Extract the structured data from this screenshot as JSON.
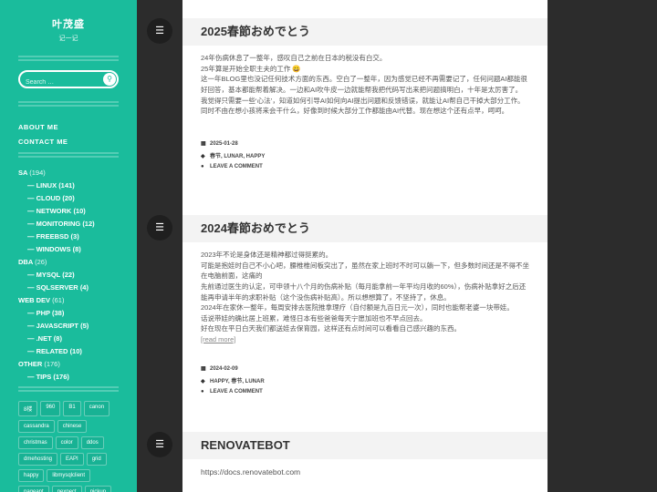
{
  "sidebar": {
    "title": "叶茂盛",
    "description": "记一记",
    "search_placeholder": "Search …",
    "search_icon": "search-icon",
    "nav": [
      "ABOUT ME",
      "CONTACT ME"
    ],
    "categories": [
      {
        "name": "SA",
        "count": "(194)",
        "children": [
          {
            "name": "LINUX",
            "count": "(141)"
          },
          {
            "name": "CLOUD",
            "count": "(20)"
          },
          {
            "name": "NETWORK",
            "count": "(10)"
          },
          {
            "name": "MONITORING",
            "count": "(12)"
          },
          {
            "name": "FREEBSD",
            "count": "(3)"
          },
          {
            "name": "WINDOWS",
            "count": "(8)"
          }
        ]
      },
      {
        "name": "DBA",
        "count": "(26)",
        "children": [
          {
            "name": "MYSQL",
            "count": "(22)"
          },
          {
            "name": "SQLSERVER",
            "count": "(4)"
          }
        ]
      },
      {
        "name": "WEB DEV",
        "count": "(61)",
        "children": [
          {
            "name": "PHP",
            "count": "(38)"
          },
          {
            "name": "JAVASCRIPT",
            "count": "(5)"
          },
          {
            "name": ".NET",
            "count": "(8)"
          },
          {
            "name": "RELATED",
            "count": "(10)"
          }
        ]
      },
      {
        "name": "OTHER",
        "count": "(176)",
        "children": [
          {
            "name": "TIPS",
            "count": "(176)"
          }
        ]
      }
    ],
    "tags": [
      "8楼",
      "960",
      "B1",
      "canon",
      "cassandra",
      "chinese",
      "christmas",
      "color",
      "ddos",
      "dmehosting",
      "EAPI",
      "grid",
      "happy",
      "libmysqlclient",
      "pageant",
      "pexpect",
      "pickup"
    ]
  },
  "posts": [
    {
      "title": "2025春節おめでとう",
      "body": [
        "24年伤病休息了一整年，感叹自己之前在日本的税没有白交。",
        "25年算是开始全职主夫的工作 😀",
        "这一年BLOG里也没记任何技术方面的东西。空白了一整年，因为感觉已经不再需要记了，任何问题AI都能很好回答，基本都能帮着解决。一边和AI吹牛皮一边就能帮我把代码写出来把问题搞明白，十年是太厉害了。",
        "我觉得只需要一些‘心法’，知道如何引导AI如何向AI提出问题和反馈错误，就能让AI帮自己干掉大部分工作。",
        "同时不由在想小孩将来会干什么，好像到时候大部分工作都能由AI代替。现在想这个还有点早，呵呵。"
      ],
      "date": "2025-01-28",
      "tags": "春节, LUNAR, HAPPY",
      "comment": "LEAVE A COMMENT"
    },
    {
      "title": "2024春節おめでとう",
      "body": [
        "2023年不论是身体还是精神都过得挺累的。",
        "可能是抱娃时自己不小心吧，腰椎椎间板突出了，虽然在家上班时不时可以躺一下，但多数时间还是不得不坐在电脑前面，这痛的",
        "先前通过医生的认定，可申领十八个月的伤病补贴（每月能拿前一年平均月收的60%），伤病补贴拿好之后还能再申请半年的求职补贴（这个没伤病补贴高）。所以想想算了，不坚持了，休息。",
        "2024年在家休一整年，每周安排去医院推拿理疗（自付额是九百日元一次），同时也能帮老婆一块带娃。",
        "话说带娃的确比居上班累，难怪日本有些爸爸每天宁愿加班也不早点回去。",
        "好在现在平日白天我们都送娃去保育园，这样还有点时间可以看看自己感兴趣的东西。"
      ],
      "read_more": "[read more]",
      "date": "2024-02-09",
      "tags": "HAPPY, 春节, LUNAR",
      "comment": "LEAVE A COMMENT"
    },
    {
      "title": "RENOVATEBOT",
      "body": [
        "https://docs.renovatebot.com"
      ]
    }
  ],
  "icons": {
    "format": "aside-format-icon",
    "calendar": "calendar-icon",
    "tag": "tag-icon",
    "comment": "comment-icon"
  }
}
